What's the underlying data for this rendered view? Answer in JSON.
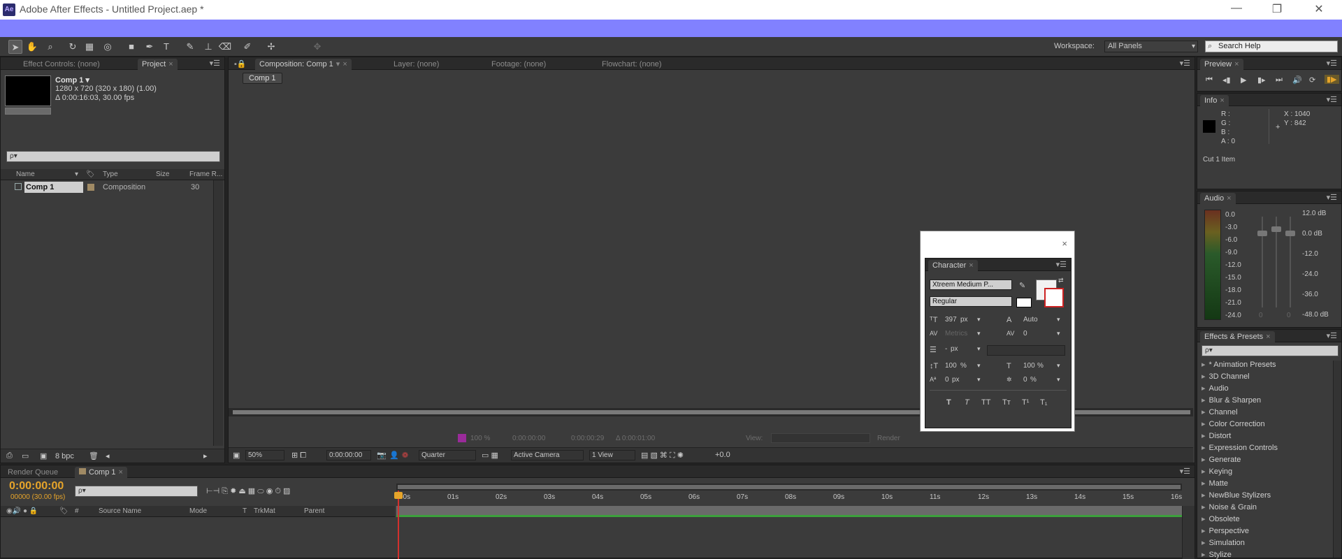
{
  "title": "Adobe After Effects - Untitled Project.aep *",
  "logo": "Ae",
  "window_controls": [
    "—",
    "❐",
    "✕"
  ],
  "workspace": {
    "label": "Workspace:",
    "value": "All Panels"
  },
  "search_help": "Search Help",
  "project_panel": {
    "tabs": [
      "Effect Controls: (none)",
      "Project"
    ],
    "comp_name": "Comp 1 ▾",
    "comp_info1": "1280 x 720  (320 x 180) (1.00)",
    "comp_info2": "Δ 0:00:16:03, 30.00 fps",
    "search_placeholder": "ρ▾",
    "columns": {
      "name": "Name",
      "type": "Type",
      "size": "Size",
      "frame_rate": "Frame R..."
    },
    "row": {
      "name": "Comp 1",
      "type": "Composition",
      "frame_rate": "30"
    },
    "bpc": "8 bpc"
  },
  "comp_panel": {
    "tabs": [
      "Composition: Comp 1",
      "Layer: (none)",
      "Footage: (none)",
      "Flowchart: (none)"
    ],
    "subtab": "Comp 1",
    "status": {
      "zoom_pct": "100 %",
      "time1": "0:00:00:00",
      "time2": "0:00:00:29",
      "time3": "Δ 0:00:01:00",
      "view_label": "View:",
      "render": "Render"
    },
    "footer": {
      "zoom": "50%",
      "time": "0:00:00:00",
      "resolution": "Quarter",
      "camera": "Active Camera",
      "views": "1 View",
      "exposure": "+0.0"
    }
  },
  "character": {
    "tab": "Character",
    "font": "Xtreem Medium P...",
    "style": "Regular",
    "size": "397",
    "size_unit": "px",
    "leading": "Auto",
    "kerning": "Metrics",
    "tracking": "0",
    "stroke_width": "-",
    "stroke_unit": "px",
    "vscale": "100",
    "hscale": "100",
    "pct": "%",
    "baseline": "0",
    "baseline_unit": "px",
    "tsume": "0",
    "style_buttons": [
      "T",
      "T",
      "TT",
      "Tт",
      "T¹",
      "T₁"
    ]
  },
  "preview": {
    "tab": "Preview"
  },
  "info": {
    "tab": "Info",
    "r": "R :",
    "g": "G :",
    "b": "B :",
    "a": "A : 0",
    "x": "X : 1040",
    "y": "Y : 842",
    "message": "Cut 1 Item"
  },
  "audio": {
    "tab": "Audio",
    "left_labels": [
      "0.0",
      "-3.0",
      "-6.0",
      "-9.0",
      "-12.0",
      "-15.0",
      "-18.0",
      "-21.0",
      "-24.0"
    ],
    "right_labels": [
      "12.0 dB",
      "0.0 dB",
      "-12.0",
      "-24.0",
      "-36.0",
      "-48.0 dB"
    ],
    "slider_zero": "0"
  },
  "effects": {
    "tab": "Effects & Presets",
    "items": [
      "* Animation Presets",
      "3D Channel",
      "Audio",
      "Blur & Sharpen",
      "Channel",
      "Color Correction",
      "Distort",
      "Expression Controls",
      "Generate",
      "Keying",
      "Matte",
      "NewBlue Stylizers",
      "Noise & Grain",
      "Obsolete",
      "Perspective",
      "Simulation",
      "Stylize"
    ]
  },
  "timeline": {
    "tabs": [
      "Render Queue",
      "Comp 1"
    ],
    "timecode": "0:00:00:00",
    "fps": "00000 (30.00 fps)",
    "columns": {
      "source": "Source Name",
      "mode": "Mode",
      "t": "T",
      "trkmat": "TrkMat",
      "parent": "Parent"
    },
    "ruler": [
      "00s",
      "01s",
      "02s",
      "03s",
      "04s",
      "05s",
      "06s",
      "07s",
      "08s",
      "09s",
      "10s",
      "11s",
      "12s",
      "13s",
      "14s",
      "15s",
      "16s"
    ]
  },
  "colors": {
    "accent": "#e6a42a",
    "purple_bar": "#8181ff",
    "work_area_green": "#3ca03c",
    "playhead": "#d2312e"
  }
}
